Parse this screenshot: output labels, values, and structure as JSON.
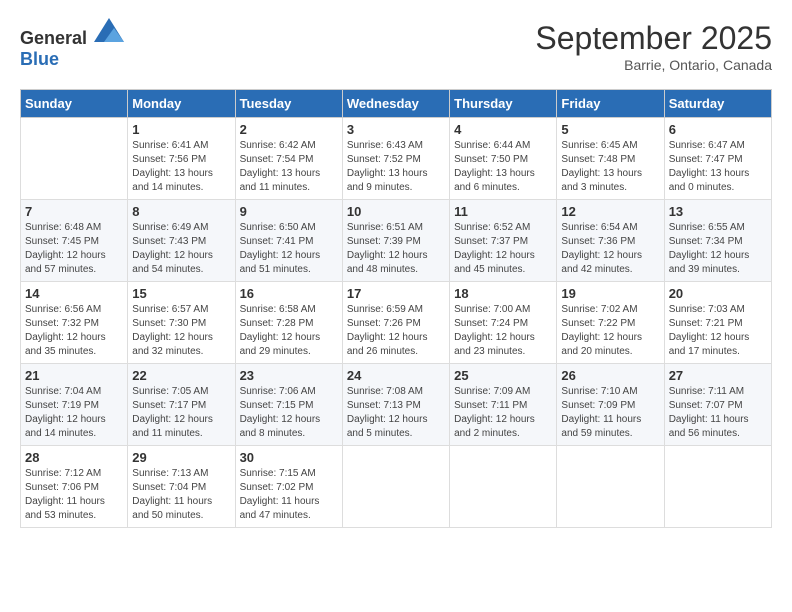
{
  "header": {
    "logo_general": "General",
    "logo_blue": "Blue",
    "month": "September 2025",
    "location": "Barrie, Ontario, Canada"
  },
  "weekdays": [
    "Sunday",
    "Monday",
    "Tuesday",
    "Wednesday",
    "Thursday",
    "Friday",
    "Saturday"
  ],
  "weeks": [
    [
      {
        "day": "",
        "sunrise": "",
        "sunset": "",
        "daylight": ""
      },
      {
        "day": "1",
        "sunrise": "Sunrise: 6:41 AM",
        "sunset": "Sunset: 7:56 PM",
        "daylight": "Daylight: 13 hours and 14 minutes."
      },
      {
        "day": "2",
        "sunrise": "Sunrise: 6:42 AM",
        "sunset": "Sunset: 7:54 PM",
        "daylight": "Daylight: 13 hours and 11 minutes."
      },
      {
        "day": "3",
        "sunrise": "Sunrise: 6:43 AM",
        "sunset": "Sunset: 7:52 PM",
        "daylight": "Daylight: 13 hours and 9 minutes."
      },
      {
        "day": "4",
        "sunrise": "Sunrise: 6:44 AM",
        "sunset": "Sunset: 7:50 PM",
        "daylight": "Daylight: 13 hours and 6 minutes."
      },
      {
        "day": "5",
        "sunrise": "Sunrise: 6:45 AM",
        "sunset": "Sunset: 7:48 PM",
        "daylight": "Daylight: 13 hours and 3 minutes."
      },
      {
        "day": "6",
        "sunrise": "Sunrise: 6:47 AM",
        "sunset": "Sunset: 7:47 PM",
        "daylight": "Daylight: 13 hours and 0 minutes."
      }
    ],
    [
      {
        "day": "7",
        "sunrise": "Sunrise: 6:48 AM",
        "sunset": "Sunset: 7:45 PM",
        "daylight": "Daylight: 12 hours and 57 minutes."
      },
      {
        "day": "8",
        "sunrise": "Sunrise: 6:49 AM",
        "sunset": "Sunset: 7:43 PM",
        "daylight": "Daylight: 12 hours and 54 minutes."
      },
      {
        "day": "9",
        "sunrise": "Sunrise: 6:50 AM",
        "sunset": "Sunset: 7:41 PM",
        "daylight": "Daylight: 12 hours and 51 minutes."
      },
      {
        "day": "10",
        "sunrise": "Sunrise: 6:51 AM",
        "sunset": "Sunset: 7:39 PM",
        "daylight": "Daylight: 12 hours and 48 minutes."
      },
      {
        "day": "11",
        "sunrise": "Sunrise: 6:52 AM",
        "sunset": "Sunset: 7:37 PM",
        "daylight": "Daylight: 12 hours and 45 minutes."
      },
      {
        "day": "12",
        "sunrise": "Sunrise: 6:54 AM",
        "sunset": "Sunset: 7:36 PM",
        "daylight": "Daylight: 12 hours and 42 minutes."
      },
      {
        "day": "13",
        "sunrise": "Sunrise: 6:55 AM",
        "sunset": "Sunset: 7:34 PM",
        "daylight": "Daylight: 12 hours and 39 minutes."
      }
    ],
    [
      {
        "day": "14",
        "sunrise": "Sunrise: 6:56 AM",
        "sunset": "Sunset: 7:32 PM",
        "daylight": "Daylight: 12 hours and 35 minutes."
      },
      {
        "day": "15",
        "sunrise": "Sunrise: 6:57 AM",
        "sunset": "Sunset: 7:30 PM",
        "daylight": "Daylight: 12 hours and 32 minutes."
      },
      {
        "day": "16",
        "sunrise": "Sunrise: 6:58 AM",
        "sunset": "Sunset: 7:28 PM",
        "daylight": "Daylight: 12 hours and 29 minutes."
      },
      {
        "day": "17",
        "sunrise": "Sunrise: 6:59 AM",
        "sunset": "Sunset: 7:26 PM",
        "daylight": "Daylight: 12 hours and 26 minutes."
      },
      {
        "day": "18",
        "sunrise": "Sunrise: 7:00 AM",
        "sunset": "Sunset: 7:24 PM",
        "daylight": "Daylight: 12 hours and 23 minutes."
      },
      {
        "day": "19",
        "sunrise": "Sunrise: 7:02 AM",
        "sunset": "Sunset: 7:22 PM",
        "daylight": "Daylight: 12 hours and 20 minutes."
      },
      {
        "day": "20",
        "sunrise": "Sunrise: 7:03 AM",
        "sunset": "Sunset: 7:21 PM",
        "daylight": "Daylight: 12 hours and 17 minutes."
      }
    ],
    [
      {
        "day": "21",
        "sunrise": "Sunrise: 7:04 AM",
        "sunset": "Sunset: 7:19 PM",
        "daylight": "Daylight: 12 hours and 14 minutes."
      },
      {
        "day": "22",
        "sunrise": "Sunrise: 7:05 AM",
        "sunset": "Sunset: 7:17 PM",
        "daylight": "Daylight: 12 hours and 11 minutes."
      },
      {
        "day": "23",
        "sunrise": "Sunrise: 7:06 AM",
        "sunset": "Sunset: 7:15 PM",
        "daylight": "Daylight: 12 hours and 8 minutes."
      },
      {
        "day": "24",
        "sunrise": "Sunrise: 7:08 AM",
        "sunset": "Sunset: 7:13 PM",
        "daylight": "Daylight: 12 hours and 5 minutes."
      },
      {
        "day": "25",
        "sunrise": "Sunrise: 7:09 AM",
        "sunset": "Sunset: 7:11 PM",
        "daylight": "Daylight: 12 hours and 2 minutes."
      },
      {
        "day": "26",
        "sunrise": "Sunrise: 7:10 AM",
        "sunset": "Sunset: 7:09 PM",
        "daylight": "Daylight: 11 hours and 59 minutes."
      },
      {
        "day": "27",
        "sunrise": "Sunrise: 7:11 AM",
        "sunset": "Sunset: 7:07 PM",
        "daylight": "Daylight: 11 hours and 56 minutes."
      }
    ],
    [
      {
        "day": "28",
        "sunrise": "Sunrise: 7:12 AM",
        "sunset": "Sunset: 7:06 PM",
        "daylight": "Daylight: 11 hours and 53 minutes."
      },
      {
        "day": "29",
        "sunrise": "Sunrise: 7:13 AM",
        "sunset": "Sunset: 7:04 PM",
        "daylight": "Daylight: 11 hours and 50 minutes."
      },
      {
        "day": "30",
        "sunrise": "Sunrise: 7:15 AM",
        "sunset": "Sunset: 7:02 PM",
        "daylight": "Daylight: 11 hours and 47 minutes."
      },
      {
        "day": "",
        "sunrise": "",
        "sunset": "",
        "daylight": ""
      },
      {
        "day": "",
        "sunrise": "",
        "sunset": "",
        "daylight": ""
      },
      {
        "day": "",
        "sunrise": "",
        "sunset": "",
        "daylight": ""
      },
      {
        "day": "",
        "sunrise": "",
        "sunset": "",
        "daylight": ""
      }
    ]
  ]
}
